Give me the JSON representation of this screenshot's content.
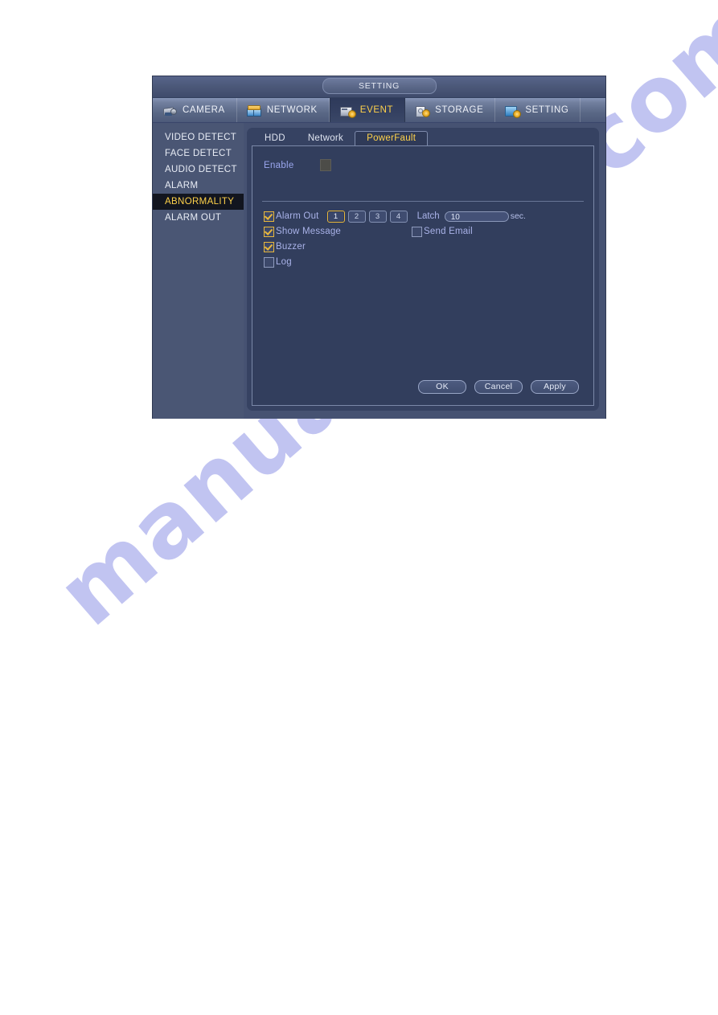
{
  "window": {
    "title": "SETTING"
  },
  "top_tabs": [
    {
      "label": "CAMERA",
      "icon": "camera-icon",
      "active": false
    },
    {
      "label": "NETWORK",
      "icon": "network-icon",
      "active": false
    },
    {
      "label": "EVENT",
      "icon": "event-icon",
      "active": true
    },
    {
      "label": "STORAGE",
      "icon": "storage-icon",
      "active": false
    },
    {
      "label": "SETTING",
      "icon": "setting-icon",
      "active": false
    }
  ],
  "sidebar": {
    "items": [
      {
        "label": "VIDEO DETECT",
        "selected": false
      },
      {
        "label": "FACE DETECT",
        "selected": false
      },
      {
        "label": "AUDIO DETECT",
        "selected": false
      },
      {
        "label": "ALARM",
        "selected": false
      },
      {
        "label": "ABNORMALITY",
        "selected": true
      },
      {
        "label": "ALARM OUT",
        "selected": false
      }
    ]
  },
  "sub_tabs": [
    {
      "label": "HDD",
      "active": false
    },
    {
      "label": "Network",
      "active": false
    },
    {
      "label": "PowerFault",
      "active": true
    }
  ],
  "form": {
    "enable_label": "Enable",
    "enable_checked": false,
    "alarm_out": {
      "label": "Alarm Out",
      "checked": true,
      "channels": [
        "1",
        "2",
        "3",
        "4"
      ],
      "selected_channel": "1"
    },
    "latch": {
      "label": "Latch",
      "value": "10",
      "unit": "sec."
    },
    "show_message": {
      "label": "Show Message",
      "checked": true
    },
    "send_email": {
      "label": "Send Email",
      "checked": false
    },
    "buzzer": {
      "label": "Buzzer",
      "checked": true
    },
    "log": {
      "label": "Log",
      "checked": false
    }
  },
  "buttons": {
    "ok": "OK",
    "cancel": "Cancel",
    "apply": "Apply"
  },
  "watermark": {
    "text": "manualshive.com"
  },
  "colors": {
    "accent_yellow": "#ffd24a",
    "label_blue": "#a9b2e8",
    "window_bg": "#465272",
    "panel_bg": "#323e5d",
    "selected_row_bg": "#12151f"
  }
}
